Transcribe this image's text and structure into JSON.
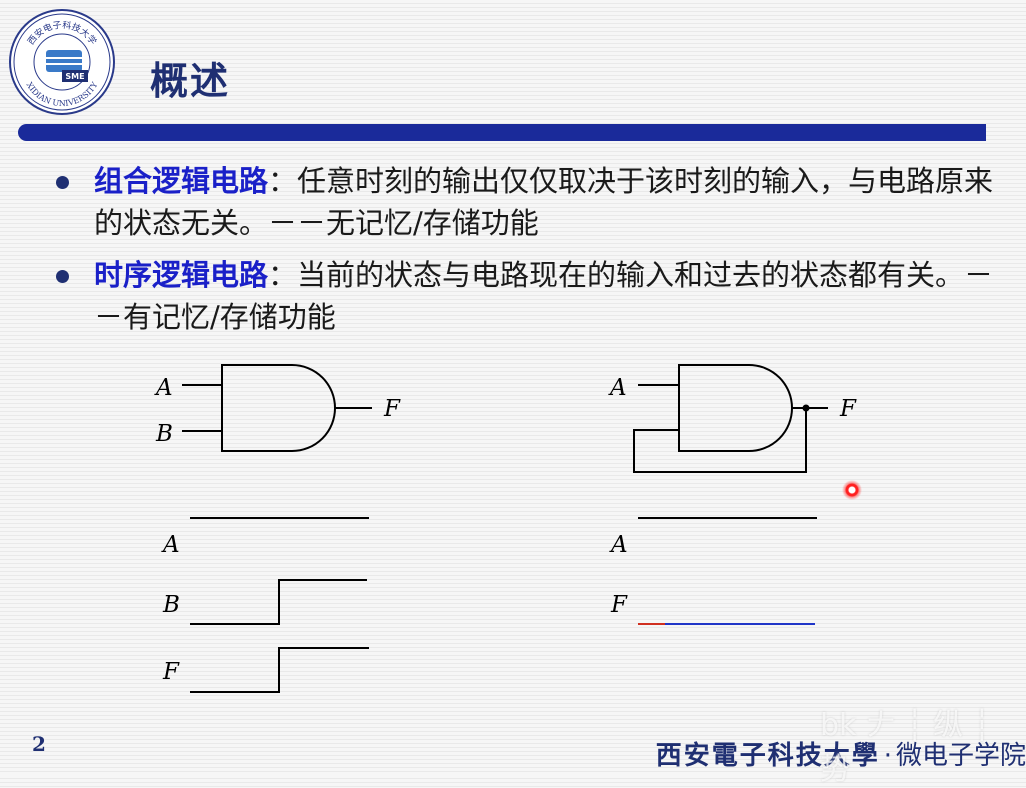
{
  "header": {
    "title": "概述",
    "logo": {
      "icon": "university-seal-icon",
      "text_top": "西安电子科技大学",
      "text_bottom": "XIDIAN UNIVERSITY",
      "badge": "SME"
    }
  },
  "bullets": [
    {
      "term": "组合逻辑电路",
      "text": "：任意时刻的输出仅仅取决于该时刻的输入，与电路原来的状态无关。－－无记忆/存储功能"
    },
    {
      "term": "时序逻辑电路",
      "text": "：当前的状态与电路现在的输入和过去的状态都有关。－－有记忆/存储功能"
    }
  ],
  "diagrams": {
    "combinational": {
      "gate": {
        "inputs": [
          "A",
          "B"
        ],
        "output": "F"
      },
      "waveform": {
        "signals": [
          "A",
          "B",
          "F"
        ]
      }
    },
    "sequential": {
      "gate": {
        "inputs": [
          "A"
        ],
        "output": "F"
      },
      "waveform": {
        "signals": [
          "A",
          "F"
        ]
      }
    }
  },
  "footer": {
    "slide_number": "2",
    "university": "西安電子科技大學",
    "separator": "·",
    "department": "微电子学院"
  },
  "watermark": "bk 𠂇 ┆ 纵 ┆ 势",
  "colors": {
    "title": "#1f2f72",
    "title_bar": "#1a2a9a",
    "term": "#1a20c8",
    "wire": "#000000",
    "trace_red": "#d03020",
    "trace_blue": "#2036c8"
  }
}
